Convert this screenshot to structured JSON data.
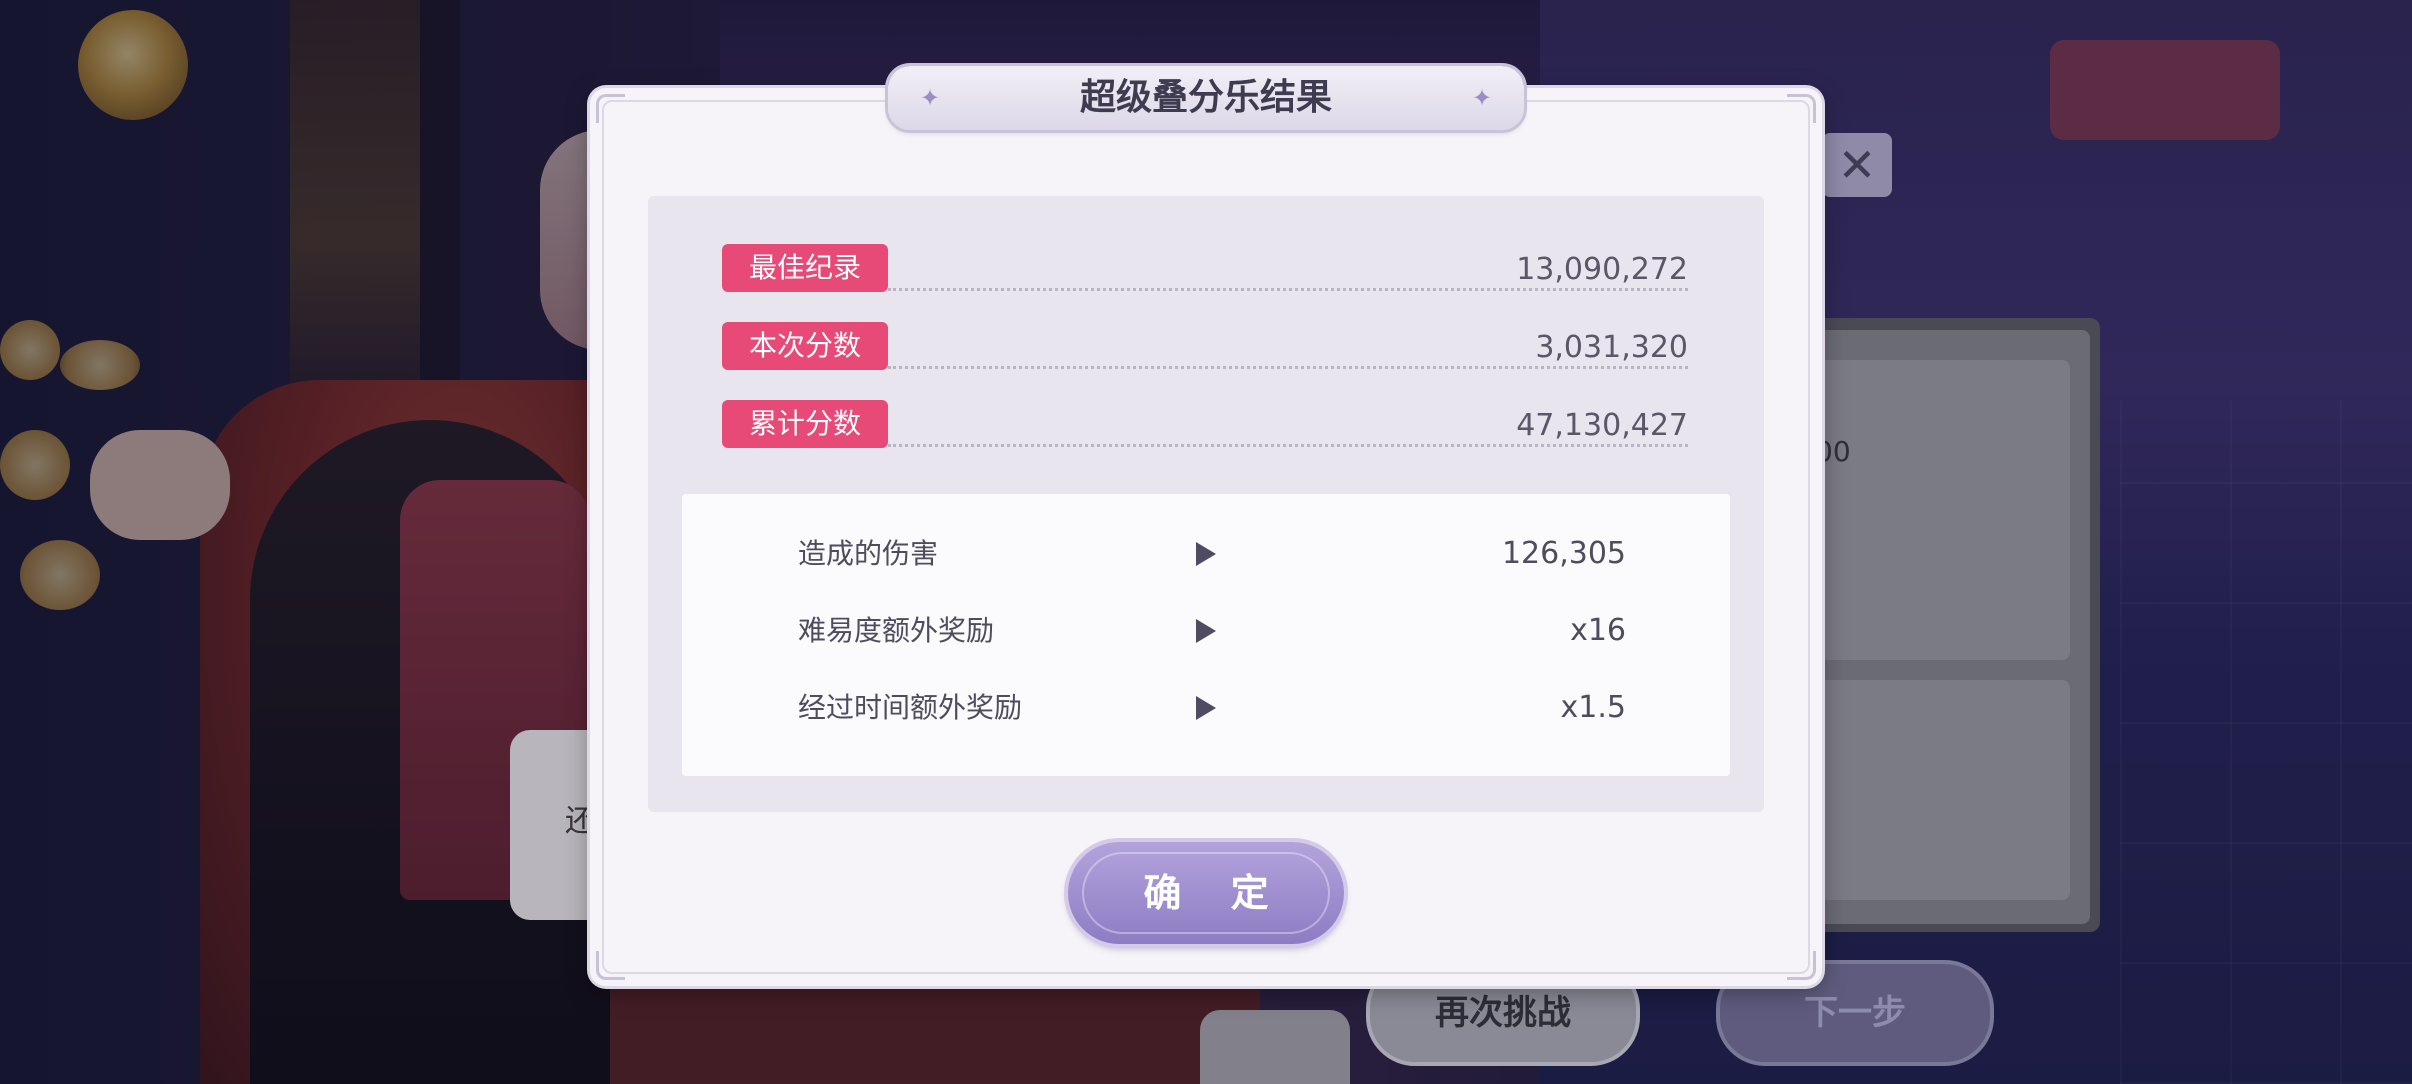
{
  "dialog": {
    "title": "超级叠分乐结果",
    "records": [
      {
        "label": "最佳纪录",
        "value": "13,090,272"
      },
      {
        "label": "本次分数",
        "value": "3,031,320"
      },
      {
        "label": "累计分数",
        "value": "47,130,427"
      }
    ],
    "bonuses": [
      {
        "label": "造成的伤害",
        "value": "126,305"
      },
      {
        "label": "难易度额外奖励",
        "value": "x16"
      },
      {
        "label": "经过时间额外奖励",
        "value": "x1.5"
      }
    ],
    "confirm_label": "确 定"
  },
  "background_screen": {
    "close_glyph": "✕",
    "partial_number": "00",
    "partial_side_text": "还",
    "retry_label": "再次挑战",
    "next_label": "下一步"
  },
  "colors": {
    "tag_pink": "#e84a78",
    "confirm_purple": "#9f8fd0",
    "panel_bg": "#f6f4f8"
  },
  "icons": {
    "title_decoration": "sparkle-icon",
    "bonus_indicator": "play-triangle-icon",
    "close": "close-icon"
  }
}
